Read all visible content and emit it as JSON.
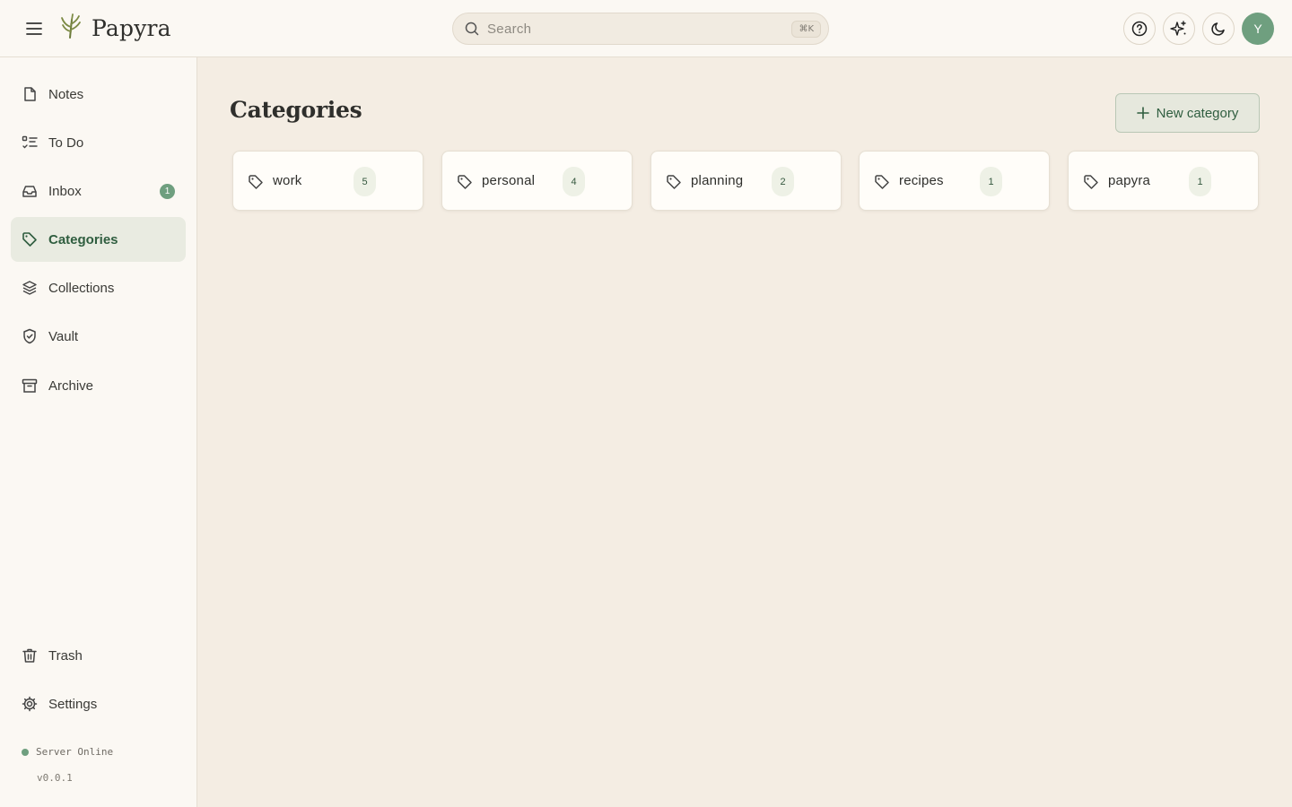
{
  "app": {
    "name": "Papyra",
    "logo_icon": "wheat-sprig-icon"
  },
  "header": {
    "search": {
      "placeholder": "Search",
      "shortcut": "⌘K"
    },
    "actions": [
      {
        "name": "help",
        "icon": "help-circle-icon"
      },
      {
        "name": "ai-sparkles",
        "icon": "sparkles-icon"
      },
      {
        "name": "dark-mode",
        "icon": "moon-icon"
      }
    ],
    "avatar_initial": "Y"
  },
  "sidebar": {
    "items": [
      {
        "label": "Notes",
        "icon": "file-icon",
        "active": false
      },
      {
        "label": "To Do",
        "icon": "checklist-icon",
        "active": false
      },
      {
        "label": "Inbox",
        "icon": "inbox-icon",
        "badge": "1",
        "active": false
      },
      {
        "label": "Categories",
        "icon": "tag-icon",
        "active": true
      },
      {
        "label": "Collections",
        "icon": "layers-icon",
        "active": false
      },
      {
        "label": "Vault",
        "icon": "shield-icon",
        "active": false
      },
      {
        "label": "Archive",
        "icon": "archive-icon",
        "active": false
      }
    ],
    "bottom_items": [
      {
        "label": "Trash",
        "icon": "trash-icon"
      },
      {
        "label": "Settings",
        "icon": "gear-icon"
      }
    ],
    "server_status": "Server Online",
    "version": "v0.0.1"
  },
  "main": {
    "title": "Categories",
    "new_button_label": "New category",
    "categories": [
      {
        "name": "work",
        "count": "5"
      },
      {
        "name": "personal",
        "count": "4"
      },
      {
        "name": "planning",
        "count": "2"
      },
      {
        "name": "recipes",
        "count": "1"
      },
      {
        "name": "papyra",
        "count": "1"
      }
    ]
  },
  "colors": {
    "accent": "#6f9f7f",
    "accent_dark": "#2f5d3f",
    "background": "#f4ede3",
    "panel": "#fbf8f3"
  }
}
